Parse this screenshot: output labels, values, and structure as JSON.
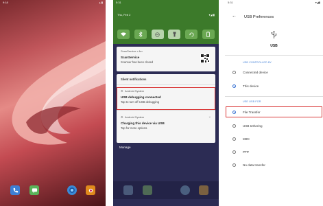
{
  "home": {
    "status_time": "9:18",
    "status_icons": "▴ ▮",
    "colors": {
      "wallpaper_primary": "#c0555a",
      "wallpaper_dark": "#4a1418"
    },
    "dock_apps": [
      {
        "name": "phone",
        "icon": "phone-icon",
        "color": "#3d7fd6"
      },
      {
        "name": "messages",
        "icon": "message-icon",
        "color": "#5ab45a"
      },
      {
        "name": "browser",
        "icon": "browser-icon",
        "color": "#3a8ad6"
      },
      {
        "name": "camera",
        "icon": "camera-icon",
        "color": "#e08a1c"
      }
    ]
  },
  "shade": {
    "status_time": "5:31",
    "header_date": "Thu, Feb 2",
    "header_icons": "▾◢ ▮",
    "quick_tiles": [
      "wifi-icon",
      "bluetooth-icon",
      "dnd-icon",
      "flashlight-icon",
      "rotate-icon",
      "battery-saver-icon"
    ],
    "scan_card": {
      "app": "ScanService • 4m",
      "title": "ScanService",
      "body": "Scanner has been closed"
    },
    "silent_header": "Silent notifications",
    "usb_debug_card": {
      "app": "Android System",
      "title": "USB debugging connected",
      "body": "Tap to turn off USB debugging"
    },
    "usb_charge_card": {
      "app": "Android System",
      "title": "Charging this device via USB",
      "body": "Tap for more options."
    },
    "manage_label": "Manage",
    "highlight_color": "#d93535"
  },
  "usb_prefs": {
    "status_time": "5:31",
    "status_icons": "▾◢▮",
    "back_label": "←",
    "title": "USB Preferences",
    "hero_label": "USB",
    "section_controlled_by": "USB CONTROLLED BY",
    "controlled_options": [
      {
        "label": "Connected device",
        "selected": false
      },
      {
        "label": "This device",
        "selected": true
      }
    ],
    "section_use_usb_for": "USE USB FOR",
    "use_options": [
      {
        "label": "File Transfer",
        "selected": true
      },
      {
        "label": "USB tethering",
        "selected": false
      },
      {
        "label": "MIDI",
        "selected": false
      },
      {
        "label": "PTP",
        "selected": false
      },
      {
        "label": "No data transfer",
        "selected": false
      }
    ],
    "accent_color": "#2f6bd1"
  }
}
